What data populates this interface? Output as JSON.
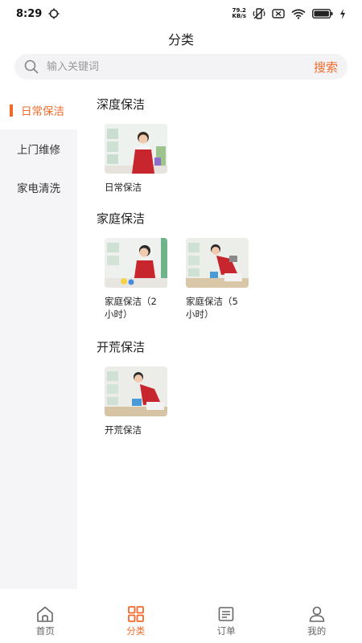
{
  "status_bar": {
    "time": "8:29",
    "net_speed_value": "79.2",
    "net_speed_unit": "KB/s",
    "battery_level": 1.0
  },
  "header": {
    "title": "分类"
  },
  "search": {
    "placeholder": "输入关键词",
    "button_label": "搜索"
  },
  "sidebar": {
    "items": [
      {
        "label": "日常保洁",
        "active": true
      },
      {
        "label": "上门维修",
        "active": false
      },
      {
        "label": "家电清洗",
        "active": false
      }
    ]
  },
  "sections": [
    {
      "title": "深度保洁",
      "services": [
        {
          "label": "日常保洁"
        }
      ]
    },
    {
      "title": "家庭保洁",
      "services": [
        {
          "label_line1": "家庭保洁（2",
          "label_line2": "小时）"
        },
        {
          "label_line1": "家庭保洁（5",
          "label_line2": "小时）"
        }
      ]
    },
    {
      "title": "开荒保洁",
      "services": [
        {
          "label": "开荒保洁"
        }
      ]
    }
  ],
  "bottom_nav": {
    "items": [
      {
        "label": "首页",
        "icon": "home-icon"
      },
      {
        "label": "分类",
        "icon": "category-grid-icon"
      },
      {
        "label": "订单",
        "icon": "order-list-icon"
      },
      {
        "label": "我的",
        "icon": "user-icon"
      }
    ]
  },
  "colors": {
    "accent": "#f26a2b",
    "sidebar_bg": "#f5f5f7",
    "search_bg": "#f3f3f5"
  }
}
